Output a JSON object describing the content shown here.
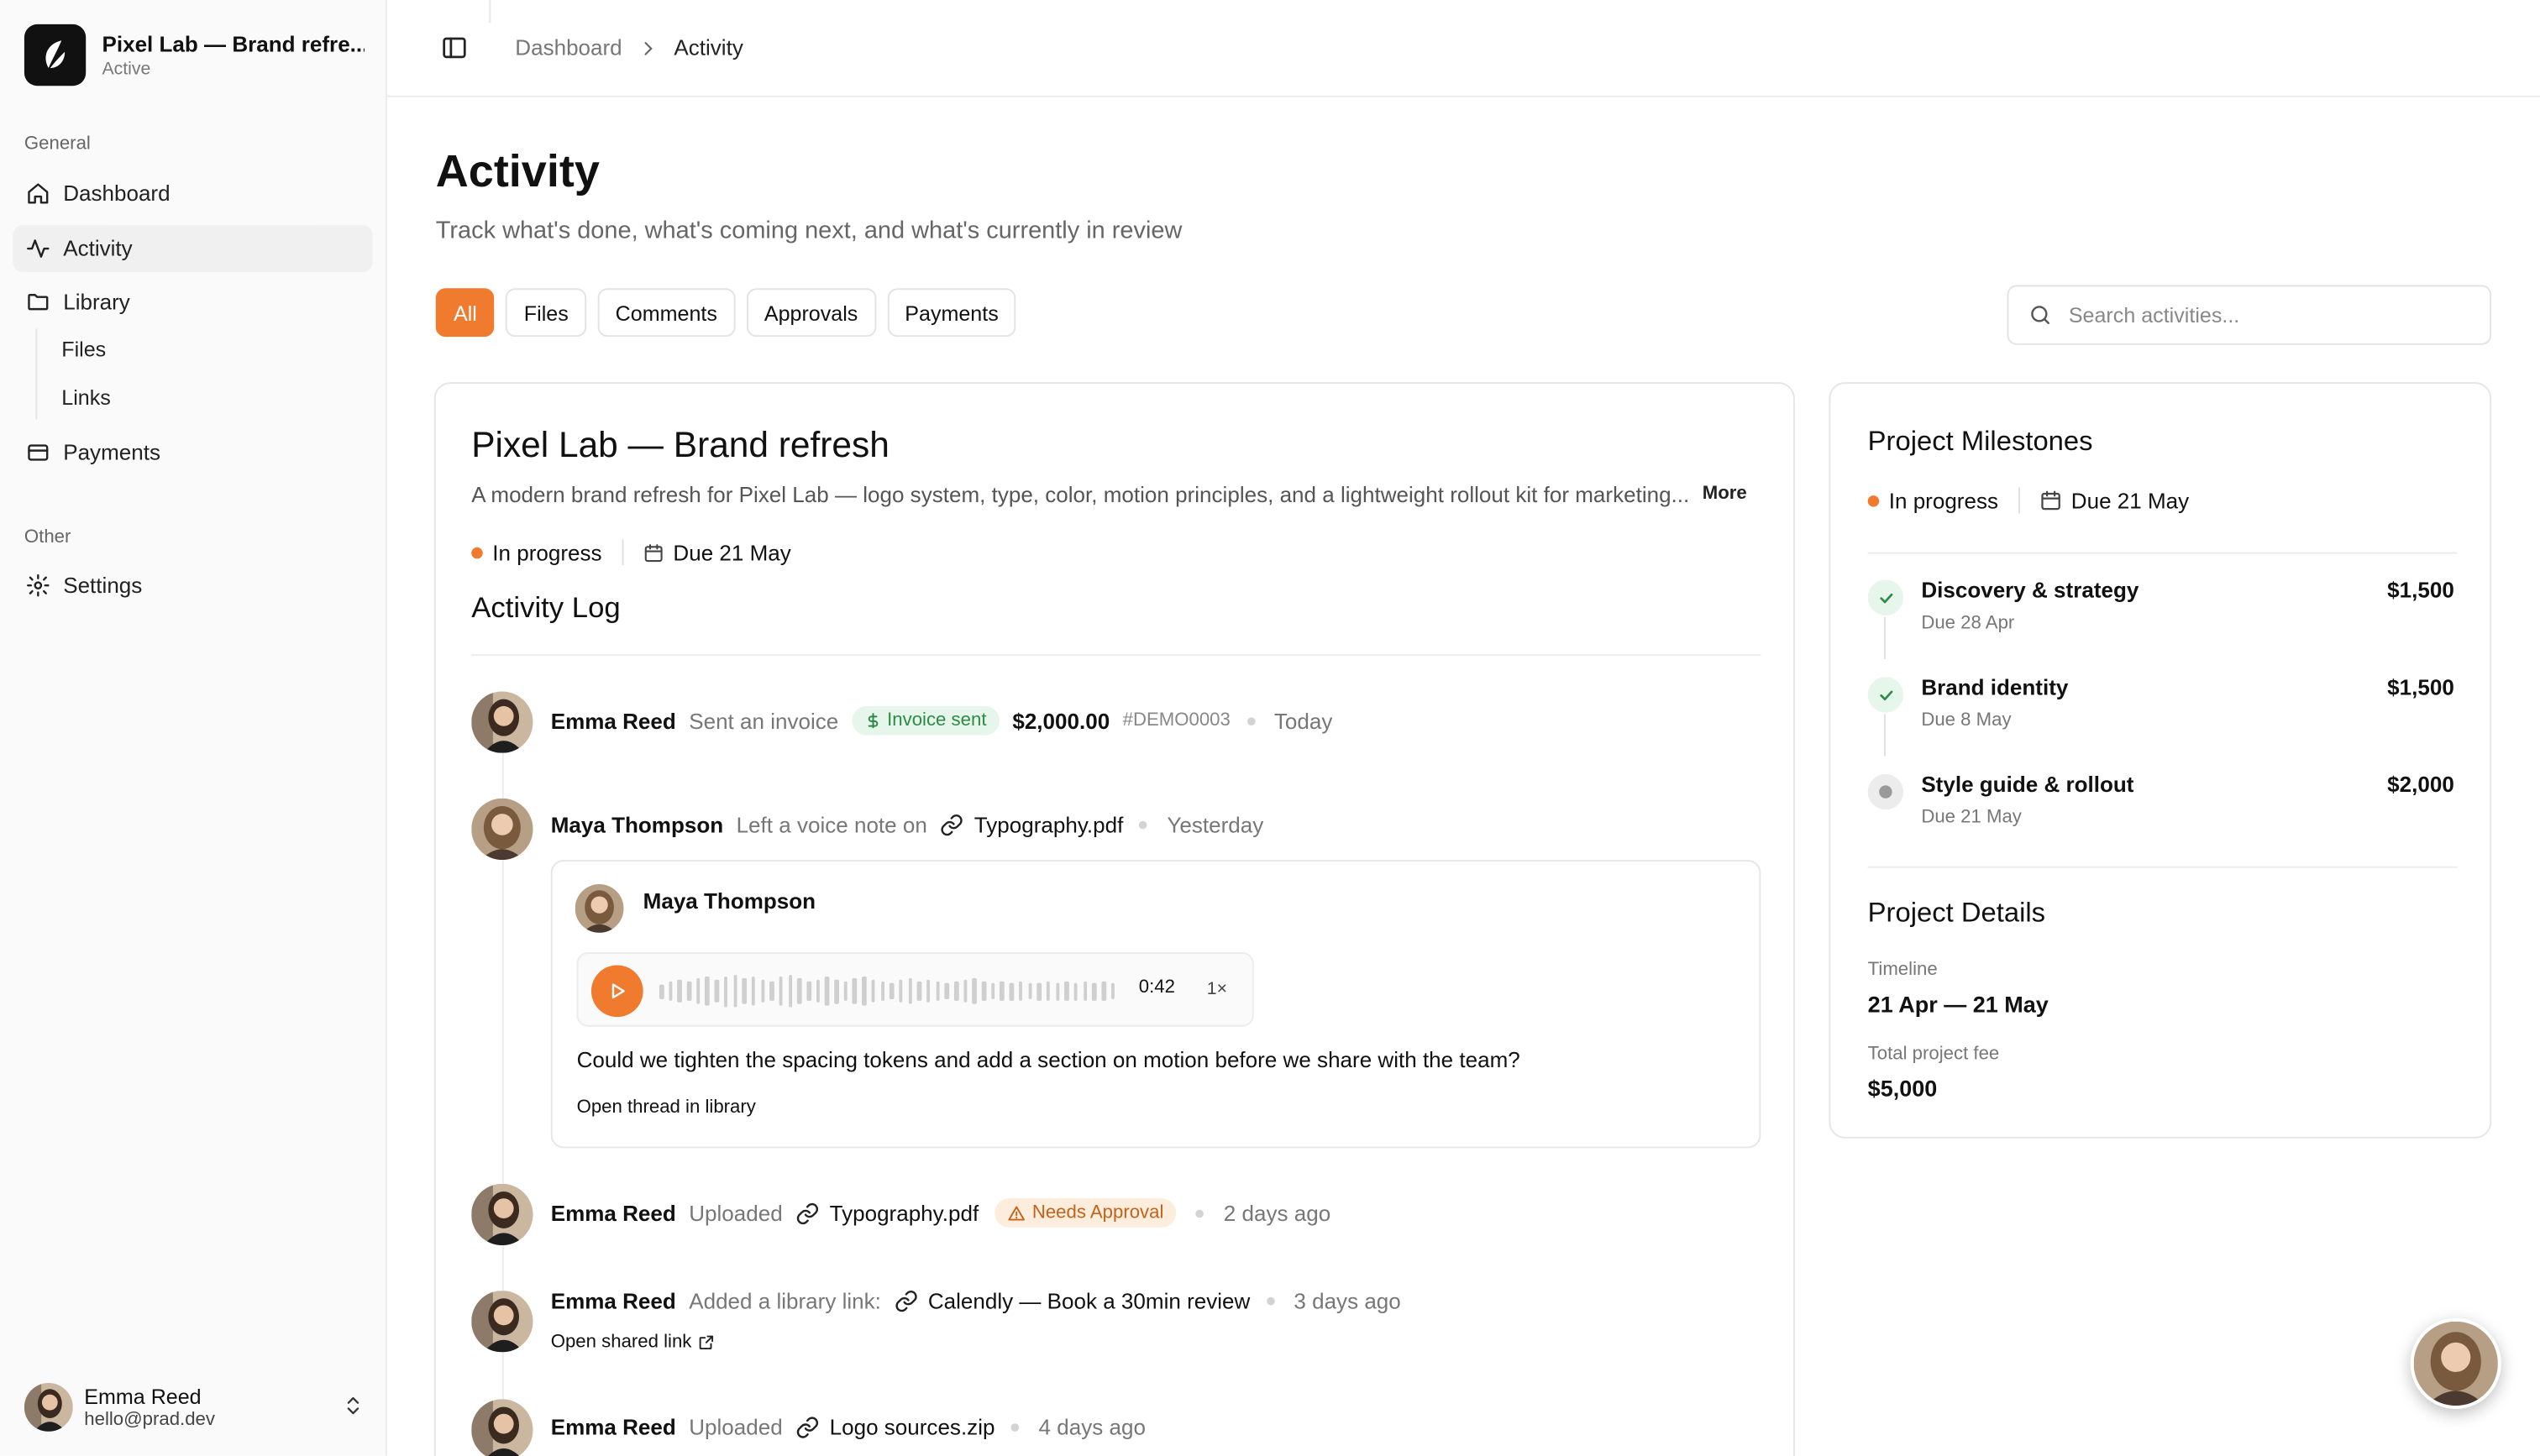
{
  "workspace": {
    "name": "Pixel Lab — Brand refre...",
    "status": "Active"
  },
  "sidebar": {
    "general_label": "General",
    "other_label": "Other",
    "items": [
      {
        "label": "Dashboard",
        "icon": "home-icon"
      },
      {
        "label": "Activity",
        "icon": "activity-icon",
        "active": true
      },
      {
        "label": "Library",
        "icon": "folder-icon"
      },
      {
        "label": "Payments",
        "icon": "credit-card-icon"
      },
      {
        "label": "Settings",
        "icon": "gear-icon"
      }
    ],
    "sub_items": [
      {
        "label": "Files"
      },
      {
        "label": "Links"
      }
    ],
    "user": {
      "name": "Emma Reed",
      "email": "hello@prad.dev"
    }
  },
  "breadcrumb": {
    "parent": "Dashboard",
    "current": "Activity"
  },
  "page": {
    "title": "Activity",
    "subtitle": "Track what's done, what's coming next, and what's currently in review"
  },
  "filters": [
    "All",
    "Files",
    "Comments",
    "Approvals",
    "Payments"
  ],
  "active_filter": "All",
  "search": {
    "placeholder": "Search activities..."
  },
  "project": {
    "title": "Pixel Lab — Brand refresh",
    "description": "A modern brand refresh for Pixel Lab — logo system, type, color, motion principles, and a lightweight rollout kit for marketing...",
    "more_label": "More",
    "status": "In progress",
    "due": "Due 21 May"
  },
  "activity_log": {
    "title": "Activity Log",
    "entries": [
      {
        "actor": "Emma Reed",
        "action": "Sent an invoice",
        "badge": "Invoice sent",
        "amount": "$2,000.00",
        "ref": "#DEMO0003",
        "time": "Today"
      },
      {
        "actor": "Maya Thompson",
        "action": "Left a voice note on",
        "target": "Typography.pdf",
        "time": "Yesterday",
        "voice_note": {
          "author": "Maya Thompson",
          "duration": "0:42",
          "speed": "1×",
          "text": "Could we tighten the spacing tokens and add a section on motion before we share with the team?",
          "link": "Open thread in library"
        }
      },
      {
        "actor": "Emma Reed",
        "action": "Uploaded",
        "target": "Typography.pdf",
        "badge": "Needs Approval",
        "time": "2 days ago"
      },
      {
        "actor": "Emma Reed",
        "action": "Added a library link:",
        "target": "Calendly — Book a 30min review",
        "time": "3 days ago",
        "link": "Open shared link"
      },
      {
        "actor": "Emma Reed",
        "action": "Uploaded",
        "target": "Logo sources.zip",
        "time": "4 days ago"
      }
    ]
  },
  "milestones": {
    "title": "Project Milestones",
    "status": "In progress",
    "due": "Due 21 May",
    "items": [
      {
        "name": "Discovery & strategy",
        "due": "Due 28 Apr",
        "amount": "$1,500",
        "state": "done"
      },
      {
        "name": "Brand identity",
        "due": "Due 8 May",
        "amount": "$1,500",
        "state": "done"
      },
      {
        "name": "Style guide & rollout",
        "due": "Due 21 May",
        "amount": "$2,000",
        "state": "pending"
      }
    ]
  },
  "details": {
    "title": "Project Details",
    "timeline_label": "Timeline",
    "timeline": "21 Apr — 21 May",
    "fee_label": "Total project fee",
    "fee": "$5,000"
  },
  "colors": {
    "accent": "#f07b2e",
    "success": "#2e8a47",
    "success_bg": "#e6f6ea",
    "warning": "#c4621a",
    "warning_bg": "#fdeddd"
  }
}
